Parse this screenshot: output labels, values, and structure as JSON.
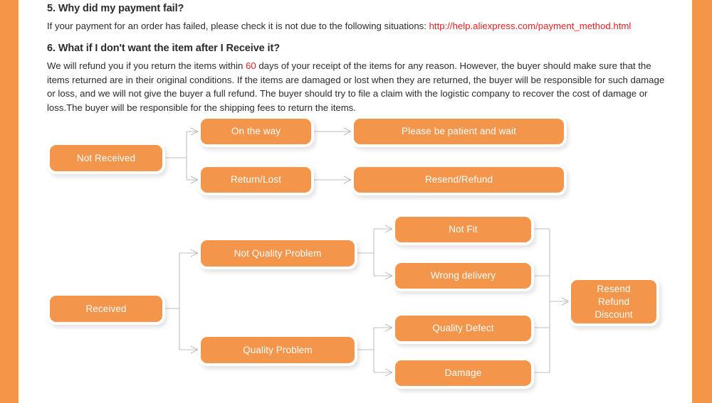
{
  "slide": {
    "background_color": "#FFFFFF",
    "edge_bar_color": "#F59547",
    "node_color": "#F3954A",
    "connector_color": "#BFBFBF",
    "accent_red": "#E02020"
  },
  "sections": {
    "q5": {
      "heading": "5. Why did my payment fail?",
      "body_before_link": "If your payment for an order has failed, please check it is not due to the following  situations: ",
      "link": "http://help.aliexpress.com/payment_method.html"
    },
    "q6": {
      "heading": "6. What if I don't want the item after I Receive it?",
      "body_part1": "We will refund you if you return the items within ",
      "days_highlight": "60",
      "body_part2": " days of your receipt of the items for any reason. However, the buyer should make sure that the items returned are in their original conditions.  If the items are damaged or lost when they are returned, the buyer will be responsible for such damage or loss, and we will not give the buyer a full refund.  The buyer should try to file a claim with the logistic company to recover the cost of damage or loss.The buyer will be responsible for the shipping fees to return the items."
    }
  },
  "flowchart_not_received": {
    "root": "Not Received",
    "branch_on_the_way": "On the way",
    "branch_on_the_way_result": "Please be patient and wait",
    "branch_return_lost": "Return/Lost",
    "branch_return_lost_result": "Resend/Refund"
  },
  "flowchart_received": {
    "root": "Received",
    "branch_not_quality": "Not Quality Problem",
    "branch_not_quality_child_1": "Not Fit",
    "branch_not_quality_child_2": "Wrong delivery",
    "branch_quality": "Quality Problem",
    "branch_quality_child_1": "Quality Defect",
    "branch_quality_child_2": "Damage",
    "outcome_line_1": "Resend",
    "outcome_line_2": "Refund",
    "outcome_line_3": "Discount"
  }
}
